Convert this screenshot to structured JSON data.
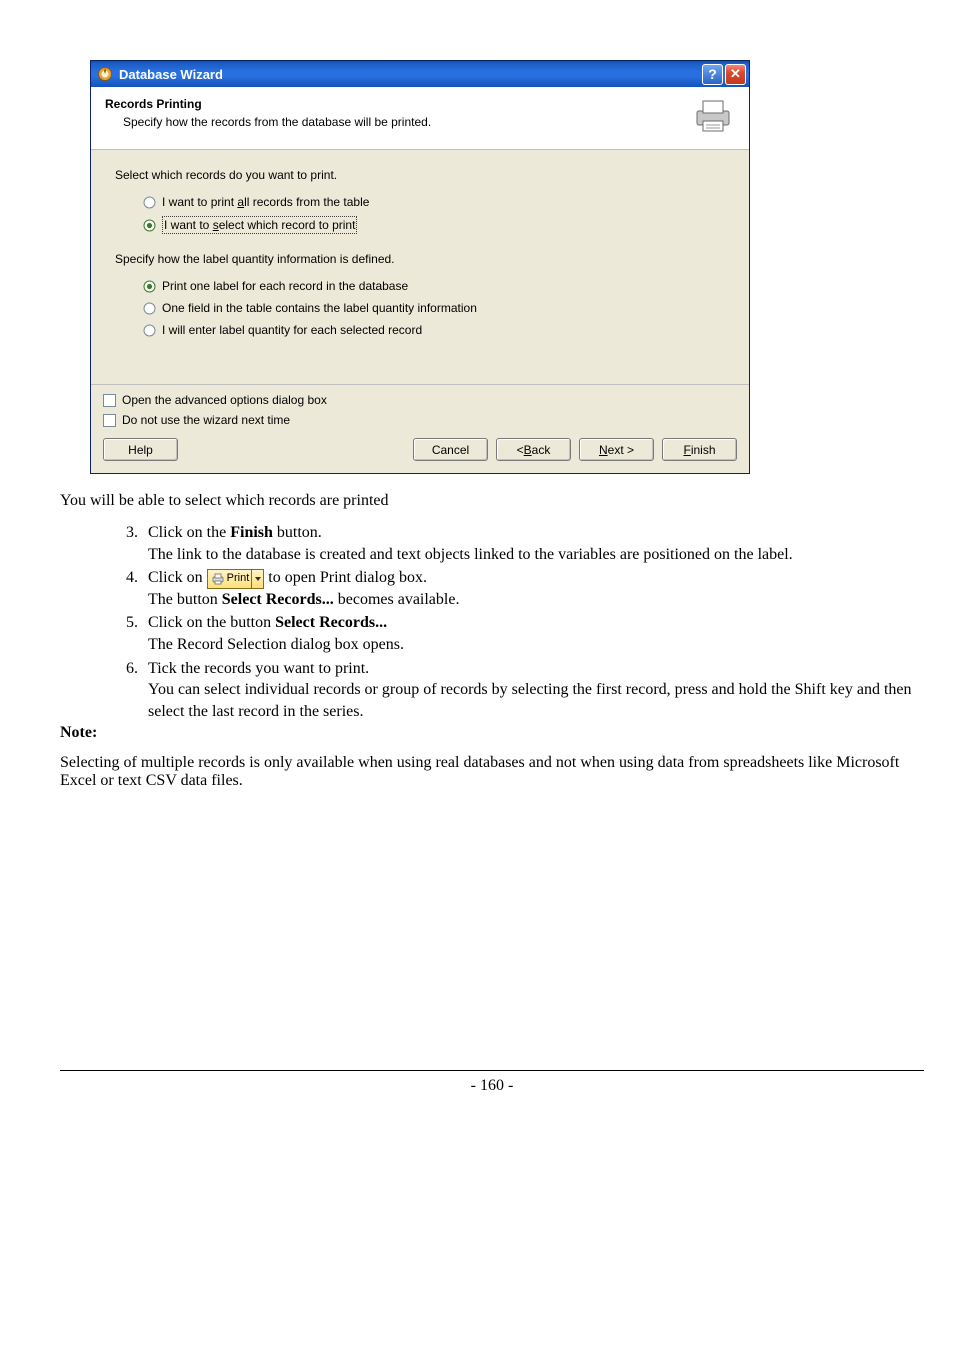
{
  "dialog": {
    "title": "Database Wizard",
    "header": {
      "title": "Records Printing",
      "subtitle": "Specify how the records from the database will be printed."
    },
    "section1_label": "Select which records do you want to print.",
    "section1_radios": {
      "r1_pre": "I want to print ",
      "r1_ul": "a",
      "r1_post": "ll records from the table",
      "r2_pre": "I want to ",
      "r2_ul": "s",
      "r2_post": "elect which record to print"
    },
    "section2_label": "Specify how the label quantity information is defined.",
    "section2_radios": {
      "r1": "Print one label for each record in the database",
      "r2": "One field in the table contains the label quantity information",
      "r3": "I will enter label quantity for each selected record"
    },
    "footer": {
      "chk1": "Open the advanced options dialog box",
      "chk2": "Do not use the wizard next time",
      "help": "Help",
      "cancel": "Cancel",
      "back_lt": "< ",
      "back_ul": "B",
      "back_post": "ack",
      "next_ul": "N",
      "next_post": "ext >",
      "finish_ul": "F",
      "finish_post": "inish"
    }
  },
  "doc": {
    "caption": "You will be able to select which records are printed",
    "step3_a": "Click on the ",
    "step3_b": "Finish",
    "step3_c": " button.",
    "step3_after": " The link to the database is created and text objects linked to the variables are positioned on the label.",
    "step4_a": "Click on ",
    "print_btn_label": "Print",
    "step4_b": " to open Print dialog box.",
    "step4_after_a": " The button ",
    "step4_after_b": "Select Records...",
    "step4_after_c": " becomes available.",
    "step5_a": "Click on the button ",
    "step5_b": "Select Records...",
    "step5_after": " The Record Selection dialog box opens.",
    "step6_a": "Tick the records you want to print.",
    "step6_after": " You can select individual records or group of records by selecting the first record, press and hold the Shift key and then select the last record in the series.",
    "note_heading": "Note:",
    "note_body": " Selecting of multiple records is only available when using real databases and not when using data from spreadsheets like Microsoft Excel or text CSV data files.",
    "page_number": "- 160 -"
  }
}
